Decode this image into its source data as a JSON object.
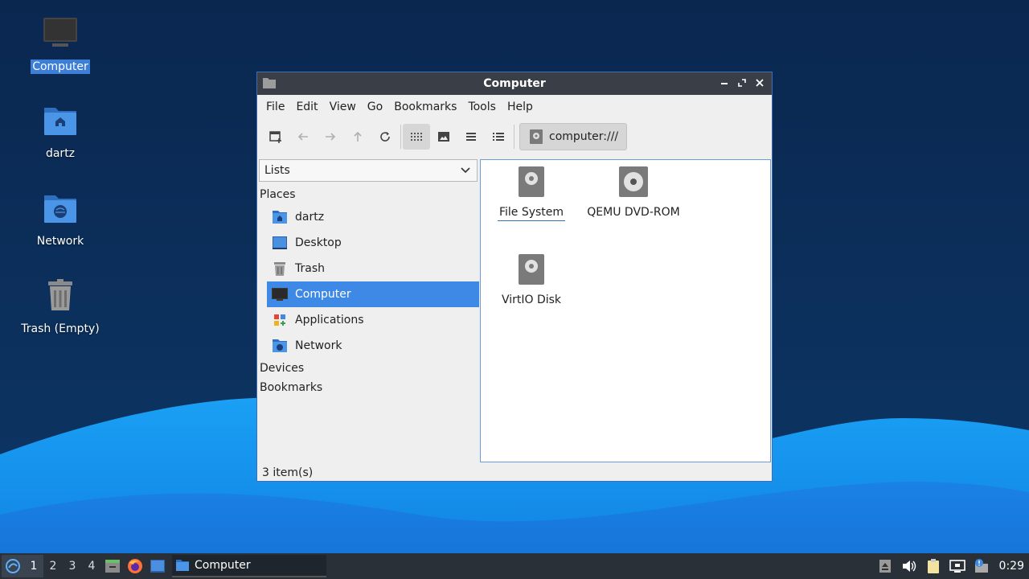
{
  "desktop": {
    "icons": [
      {
        "label": "Computer",
        "icon": "computer-icon",
        "selected": true
      },
      {
        "label": "dartz",
        "icon": "home-folder-icon"
      },
      {
        "label": "Network",
        "icon": "network-folder-icon"
      },
      {
        "label": "Trash (Empty)",
        "icon": "trash-icon"
      }
    ]
  },
  "window": {
    "title": "Computer",
    "menu": [
      "File",
      "Edit",
      "View",
      "Go",
      "Bookmarks",
      "Tools",
      "Help"
    ],
    "location": "computer:///",
    "side_pane_mode": "Lists",
    "sidebar": {
      "places_header": "Places",
      "items": [
        {
          "label": "dartz",
          "icon": "home-folder-icon"
        },
        {
          "label": "Desktop",
          "icon": "desktop-icon"
        },
        {
          "label": "Trash",
          "icon": "trash-icon"
        },
        {
          "label": "Computer",
          "icon": "computer-icon",
          "selected": true
        },
        {
          "label": "Applications",
          "icon": "applications-icon"
        },
        {
          "label": "Network",
          "icon": "network-folder-icon"
        }
      ],
      "devices_header": "Devices",
      "bookmarks_header": "Bookmarks"
    },
    "files": [
      {
        "label": "File System",
        "icon": "drive-icon",
        "focused": true
      },
      {
        "label": "QEMU DVD-ROM",
        "icon": "optical-drive-icon"
      },
      {
        "label": "VirtIO Disk",
        "icon": "drive-icon"
      }
    ],
    "status": "3 item(s)"
  },
  "taskbar": {
    "workspaces": [
      "1",
      "2",
      "3",
      "4"
    ],
    "active_workspace": "1",
    "task_label": "Computer",
    "clock": "0:29"
  },
  "colors": {
    "accent": "#3e89e5",
    "titlebar": "#3a3f47",
    "taskbar": "#293038",
    "wallpaper_dark": "#0b2a55",
    "wallpaper_light": "#1f8ef0"
  }
}
